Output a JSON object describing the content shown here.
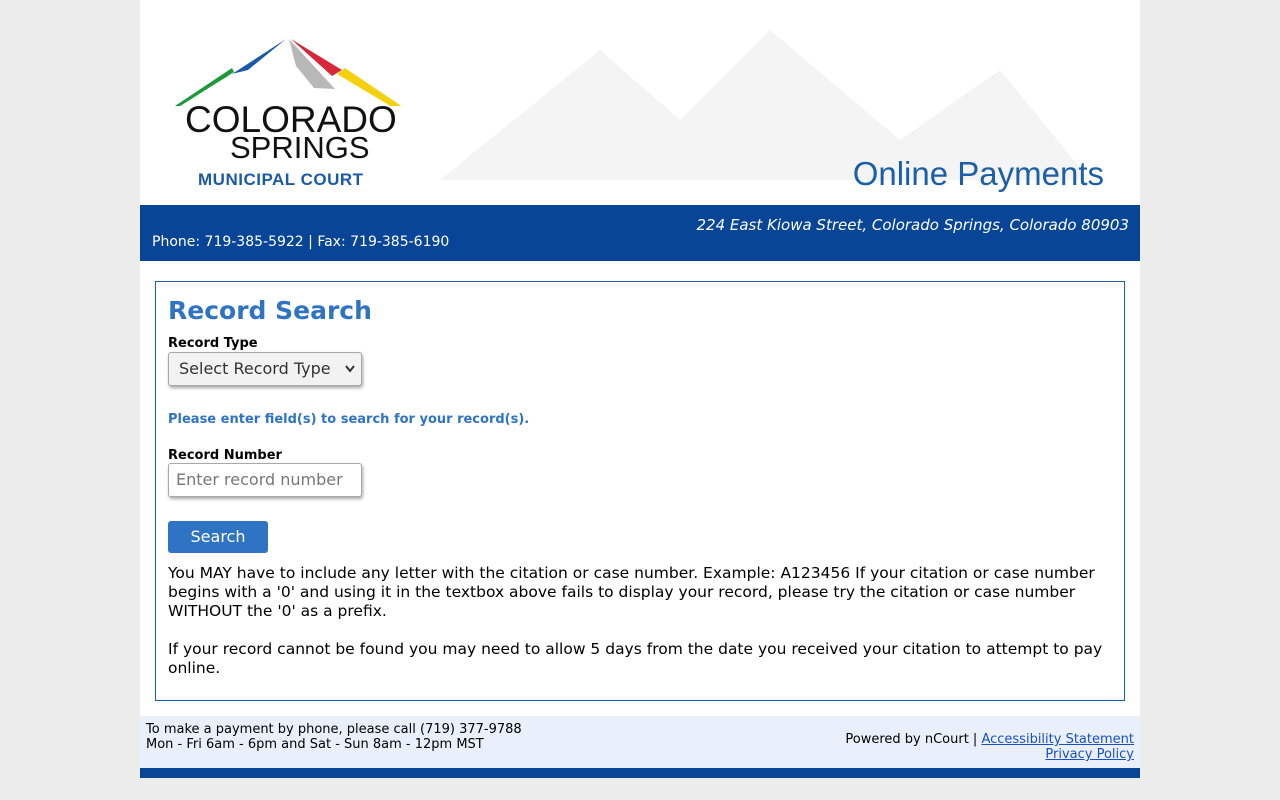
{
  "header": {
    "logo": {
      "line1": "COLORADO",
      "line2": "SPRINGS",
      "line3": "MUNICIPAL COURT"
    },
    "title": "Online Payments"
  },
  "bar": {
    "address": "224 East Kiowa Street, Colorado Springs, Colorado 80903",
    "phone": "Phone: 719-385-5922 | Fax: 719-385-6190"
  },
  "search": {
    "title": "Record Search",
    "record_type_label": "Record Type",
    "record_type_selected": "Select Record Type",
    "hint": "Please enter field(s) to search for your record(s).",
    "record_number_label": "Record Number",
    "record_number_value": "",
    "record_number_placeholder": "Enter record number",
    "search_button": "Search",
    "note1": "You MAY have to include any letter with the citation or case number. Example: A123456 If your citation or case number begins with a '0' and using it in the textbox above fails to display your record, please try the citation or case number WITHOUT the '0' as a prefix.",
    "note2": "If your record cannot be found you may need to allow 5 days from the date you received your citation to attempt to pay online."
  },
  "footer": {
    "phone_line": "To make a payment by phone, please call (719) 377-9788",
    "hours_line": "Mon - Fri 6am - 6pm and Sat - Sun 8am - 12pm MST",
    "powered_by": "Powered by nCourt |",
    "accessibility_link": "Accessibility Statement",
    "privacy_link": "Privacy Policy"
  },
  "colors": {
    "brand_blue": "#084597",
    "accent_blue": "#2f73c4",
    "title_blue": "#1a5fa8",
    "footer_bg": "#e9f0fb",
    "logo_green": "#1a9a3a",
    "logo_blue": "#1b5aa8",
    "logo_gray": "#b8b8b8",
    "logo_red": "#d8263a",
    "logo_yellow": "#f4d10c"
  }
}
